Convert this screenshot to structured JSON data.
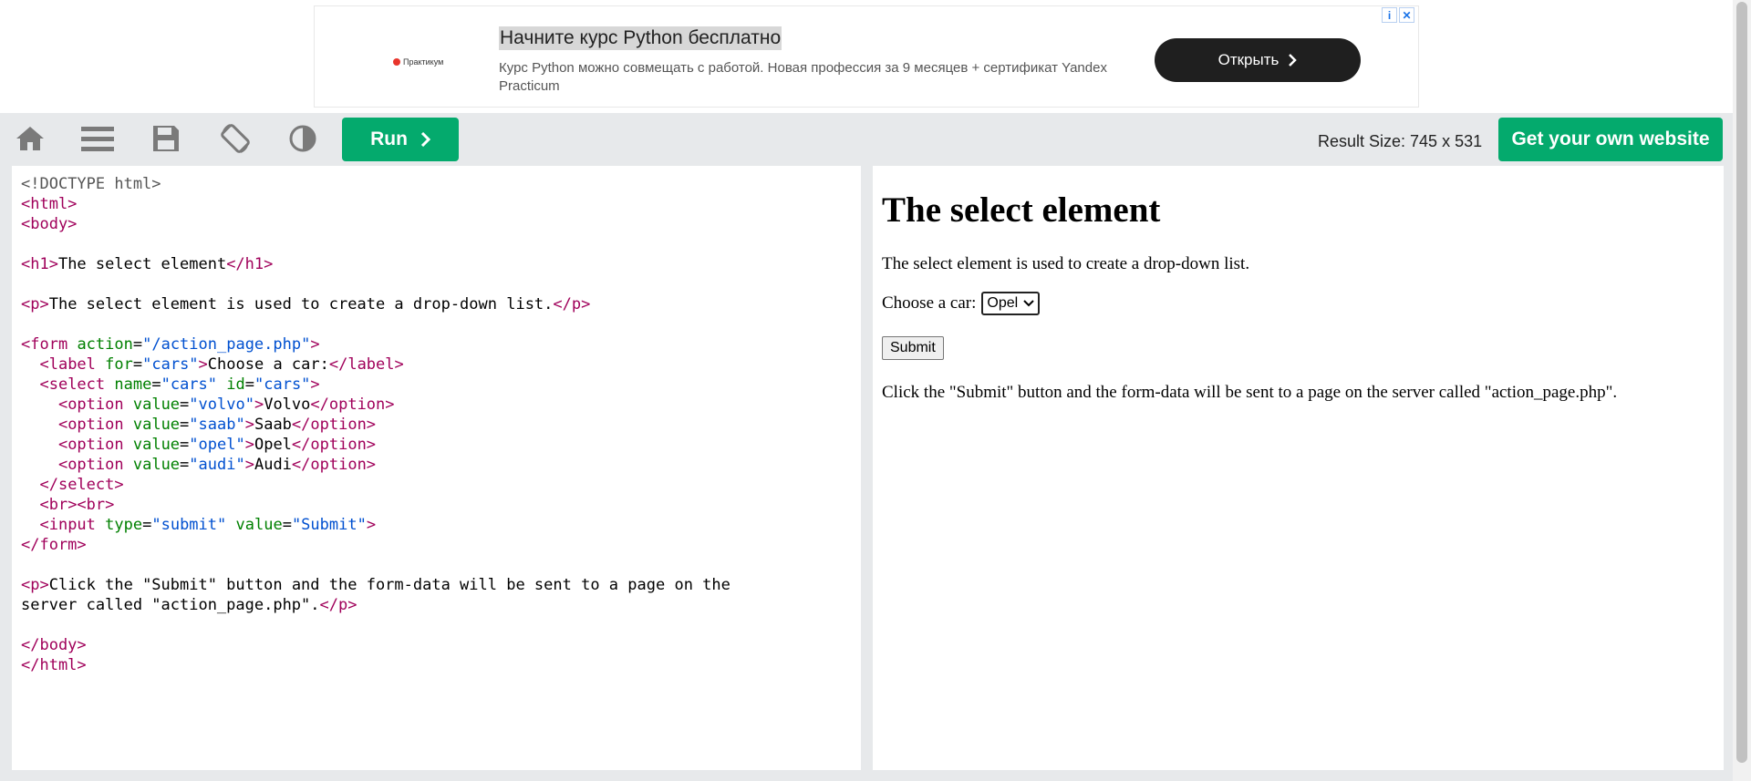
{
  "ad": {
    "logo": "Практикум",
    "title": "Начните курс Python бесплатно",
    "description": "Курс Python можно совмещать с работой. Новая профессия за 9 месяцев + сертификат Yandex Practicum",
    "cta": "Открыть"
  },
  "toolbar": {
    "home_icon": "home-icon",
    "menu_icon": "menu-icon",
    "save_icon": "save-icon",
    "rotate_icon": "rotate-icon",
    "contrast_icon": "contrast-icon",
    "run_label": "Run",
    "result_size": "Result Size: 745 x 531",
    "get_site_label": "Get your own website"
  },
  "code": {
    "doctype": "<!DOCTYPE html>",
    "h1_text": "The select element",
    "p1_text": "The select element is used to create a drop-down list.",
    "form_action": "\"/action_page.php\"",
    "label_for": "\"cars\"",
    "label_text": "Choose a car:",
    "select_name": "\"cars\"",
    "select_id": "\"cars\"",
    "options": [
      {
        "value": "\"volvo\"",
        "text": "Volvo"
      },
      {
        "value": "\"saab\"",
        "text": "Saab"
      },
      {
        "value": "\"opel\"",
        "text": "Opel"
      },
      {
        "value": "\"audi\"",
        "text": "Audi"
      }
    ],
    "input_type": "\"submit\"",
    "input_value": "\"Submit\"",
    "p2_line1": "Click the \"Submit\" button and the form-data will be sent to a page on the",
    "p2_line2": "server called \"action_page.php\"."
  },
  "result": {
    "heading": "The select element",
    "p1": "The select element is used to create a drop-down list.",
    "label": "Choose a car:",
    "selected": "Opel",
    "submit": "Submit",
    "p2": "Click the \"Submit\" button and the form-data will be sent to a page on the server called \"action_page.php\"."
  },
  "colors": {
    "green": "#04aa6d",
    "toolbar_bg": "#e7e9eb"
  }
}
